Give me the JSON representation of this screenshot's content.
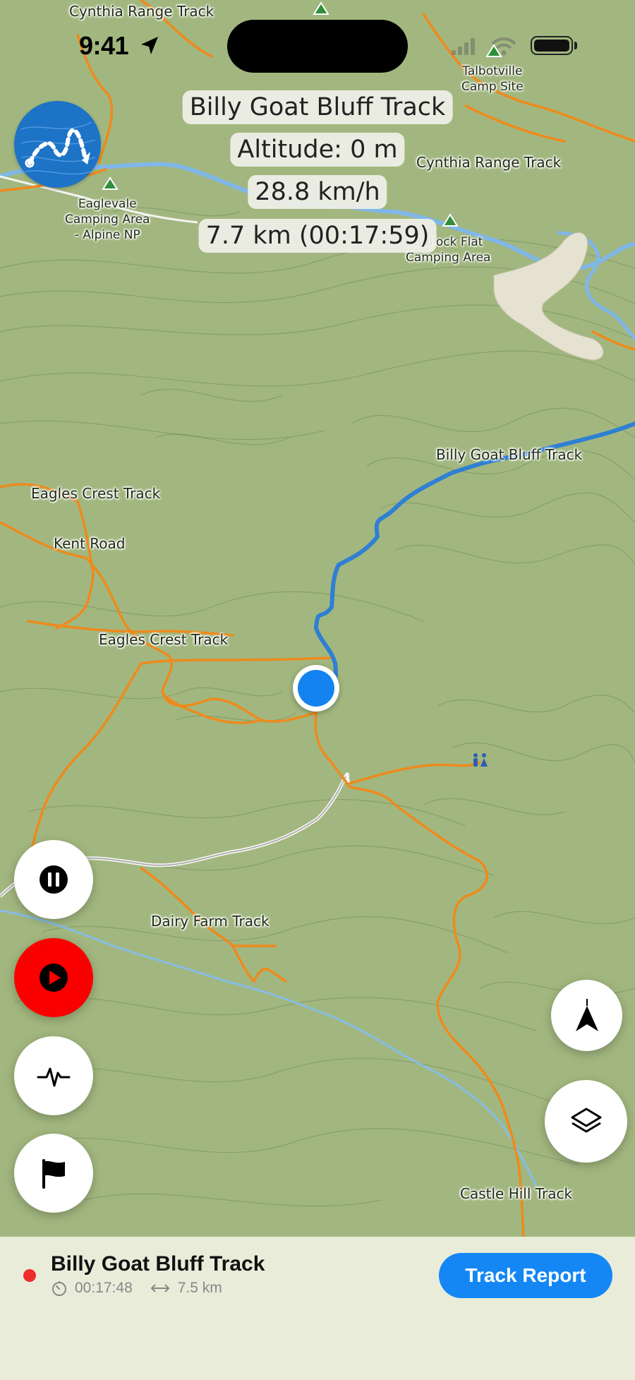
{
  "status_bar": {
    "time": "9:41"
  },
  "overlay": {
    "track_name": "Billy Goat Bluff Track",
    "altitude": "Altitude: 0 m",
    "speed": "28.8 km/h",
    "distance_time": "7.7 km (00:17:59)"
  },
  "map_labels": {
    "cynthia_top": "Cynthia Range Track",
    "talbotville": "Talbotville\nCamp Site",
    "cynthia_right": "Cynthia Range Track",
    "eaglevale": "Eaglevale\nCamping Area\n- Alpine NP",
    "bullock_flat": "Bullock Flat\nCamping Area",
    "billy_goat": "Billy Goat Bluff Track",
    "eagles_crest_top": "Eagles Crest Track",
    "kent_road": "Kent Road",
    "eagles_crest_mid": "Eagles Crest Track",
    "dairy_farm": "Dairy Farm Track",
    "castle_hill": "Castle Hill Track"
  },
  "controls": {
    "pause_icon": "pause-icon",
    "record_icon": "play-record-icon",
    "activity_icon": "activity-pulse-icon",
    "flag_icon": "flag-icon",
    "compass_icon": "north-arrow-icon",
    "layers_icon": "layers-icon"
  },
  "panel": {
    "title": "Billy Goat Bluff Track",
    "elapsed": "00:17:48",
    "distance": "7.5 km",
    "button_label": "Track Report"
  },
  "colors": {
    "map_bg": "#a2b77f",
    "track_orange": "#ee8a1c",
    "route_blue": "#2f7fd3",
    "river_blue": "#7fb7e8",
    "record_red": "#fb0000",
    "accent_blue": "#1487f5"
  }
}
